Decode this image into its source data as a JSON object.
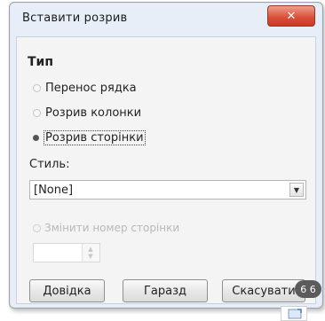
{
  "dialog": {
    "title": "Вставити розрив",
    "close_label": "✕",
    "group_label": "Тип",
    "options": [
      {
        "label": "Перенос рядка",
        "checked": false
      },
      {
        "label": "Розрив колонки",
        "checked": false
      },
      {
        "label": "Розрив сторінки",
        "checked": true
      }
    ],
    "style_label": "Стиль:",
    "style_value": "[None]",
    "dropdown_icon": "▼",
    "change_page_number_label": "Змінити номер сторінки",
    "page_number_value": "",
    "spin_up": "▲",
    "spin_down": "▼",
    "buttons": {
      "help": "Довідка",
      "ok": "Гаразд",
      "cancel": "Скасувати"
    }
  },
  "overlay": {
    "help_badge": "6 6"
  },
  "colors": {
    "close_button": "#d9523c",
    "dialog_frame": "#e7eef7",
    "disabled_text": "#b8b8b8"
  },
  "icons": {
    "close": "close-icon",
    "dropdown": "chevron-down-icon",
    "corner": "window-thumbnail-icon"
  }
}
